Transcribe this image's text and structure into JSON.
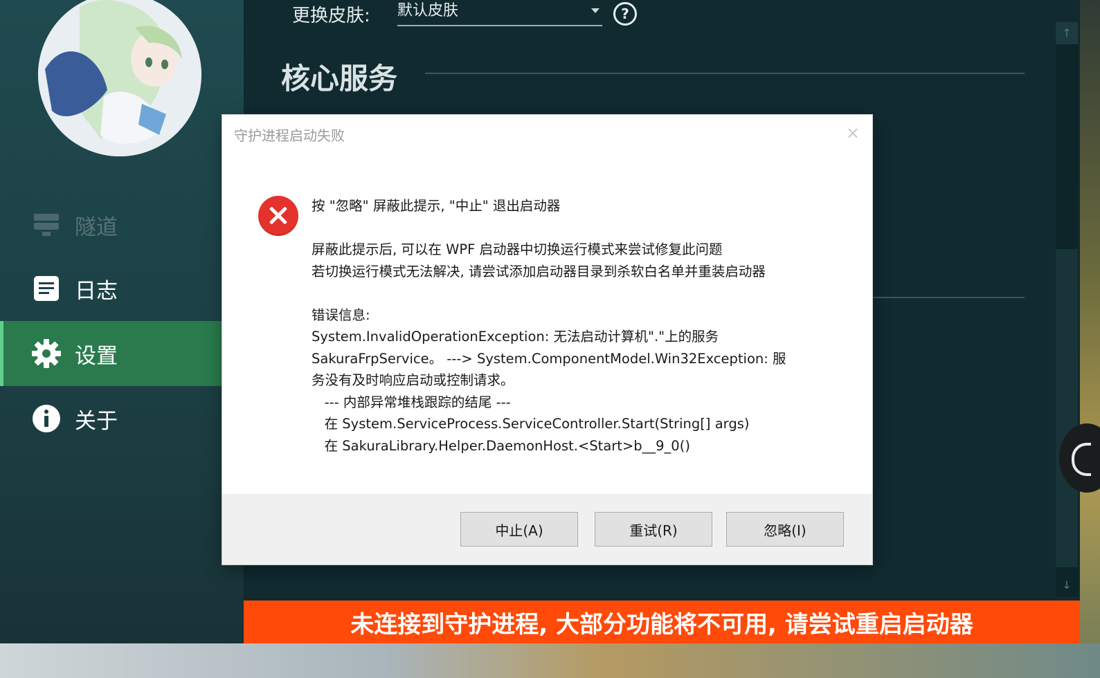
{
  "sidebar": {
    "items": [
      {
        "label": "隧道",
        "icon": "server-icon"
      },
      {
        "label": "日志",
        "icon": "document-icon"
      },
      {
        "label": "设置",
        "icon": "gear-icon"
      },
      {
        "label": "关于",
        "icon": "info-icon"
      }
    ],
    "active": "设置"
  },
  "settings": {
    "skin_label": "更换皮肤:",
    "skin_value": "默认皮肤",
    "section_title": "核心服务"
  },
  "dialog": {
    "title": "守护进程启动失败",
    "close": "×",
    "lines": [
      "按 \"忽略\" 屏蔽此提示, \"中止\" 退出启动器",
      "",
      "屏蔽此提示后, 可以在 WPF 启动器中切换运行模式来尝试修复此问题",
      "若切换运行模式无法解决, 请尝试添加启动器目录到杀软白名单并重装启动器",
      "",
      "错误信息:",
      "System.InvalidOperationException: 无法启动计算机\".\"上的服务",
      "SakuraFrpService。 ---> System.ComponentModel.Win32Exception: 服",
      "务没有及时响应启动或控制请求。",
      "   --- 内部异常堆栈跟踪的结尾 ---",
      "   在 System.ServiceProcess.ServiceController.Start(String[] args)",
      "   在 SakuraLibrary.Helper.DaemonHost.<Start>b__9_0()"
    ],
    "buttons": {
      "abort": "中止(A)",
      "retry": "重试(R)",
      "ignore": "忽略(I)"
    }
  },
  "warning_bar": {
    "text": "未连接到守护进程, 大部分功能将不可用, 请尝试重启启动器",
    "color": "#ff4a0a"
  },
  "colors": {
    "sidebar_active": "#2a7a4e",
    "main_bg": "#102a2f",
    "error_red": "#e5322d"
  }
}
